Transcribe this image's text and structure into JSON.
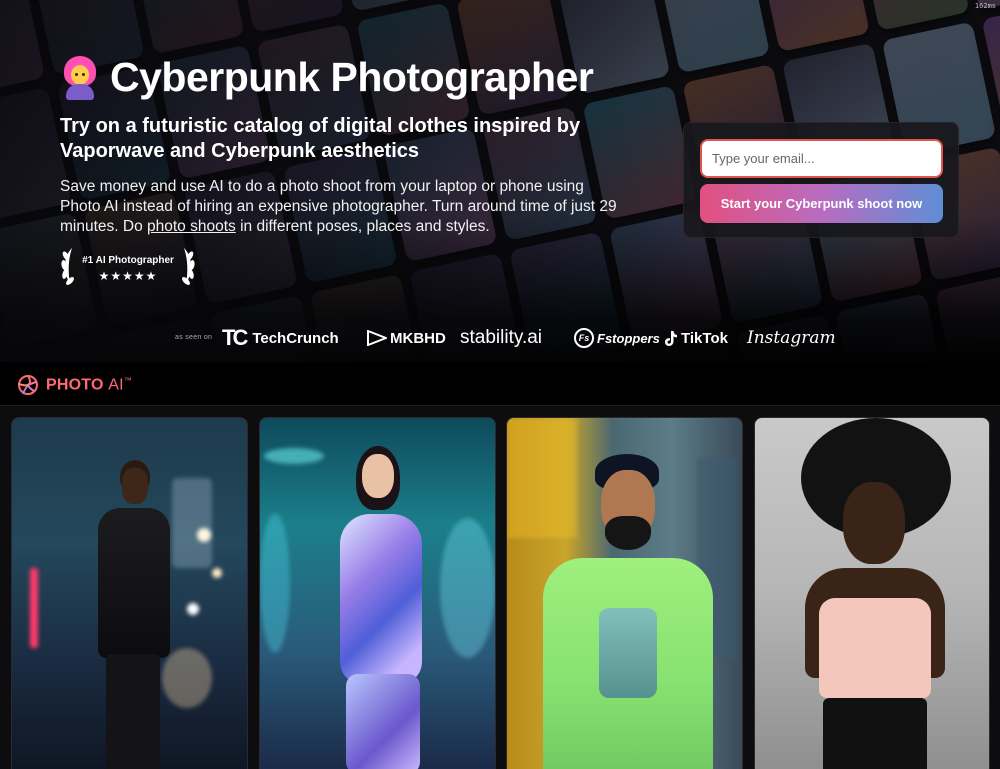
{
  "meta": {
    "timing": "162ms"
  },
  "hero": {
    "title": "Cyberpunk Photographer",
    "title_icon": "cyberpunk-person-emoji",
    "subtitle": "Try on a futuristic catalog of digital clothes inspired by Vaporwave and Cyberpunk aesthetics",
    "description_before": "Save money and use AI to do a photo shoot from your laptop or phone using Photo AI instead of hiring an expensive photographer. Turn around time of just 29 minutes. Do ",
    "description_link": "photo shoots",
    "description_after": " in different poses, places and styles.",
    "award": {
      "label": "#1 AI Photographer",
      "stars": "★★★★★",
      "rating": 5
    }
  },
  "signup": {
    "email_placeholder": "Type your email...",
    "cta_label": "Start your Cyberpunk shoot now"
  },
  "press": {
    "as_seen_on": "as seen on",
    "logos": [
      {
        "name": "techcrunch",
        "text": "TechCrunch",
        "mark": "TC"
      },
      {
        "name": "mkbhd",
        "text": "MKBHD"
      },
      {
        "name": "stability",
        "text": "stability.ai"
      },
      {
        "name": "fstoppers",
        "text": "Fstoppers",
        "mark": "Fs"
      },
      {
        "name": "tiktok",
        "text": "TikTok"
      },
      {
        "name": "instagram",
        "text": "Instagram"
      }
    ]
  },
  "brand": {
    "name": "PHOTO",
    "suffix": "AI",
    "tm": "™",
    "color": "#ff6a72"
  },
  "gallery": {
    "photos": [
      {
        "name": "man-leather-jacket-night-city"
      },
      {
        "name": "woman-metallic-bodysuit-neon"
      },
      {
        "name": "bearded-man-printed-tshirt"
      },
      {
        "name": "woman-afro-pink-crop-top"
      }
    ]
  },
  "colors": {
    "accent_pink": "#e2507f",
    "accent_blue": "#5f8ed6",
    "input_border": "#e0564c",
    "background": "#0a0a0c"
  }
}
